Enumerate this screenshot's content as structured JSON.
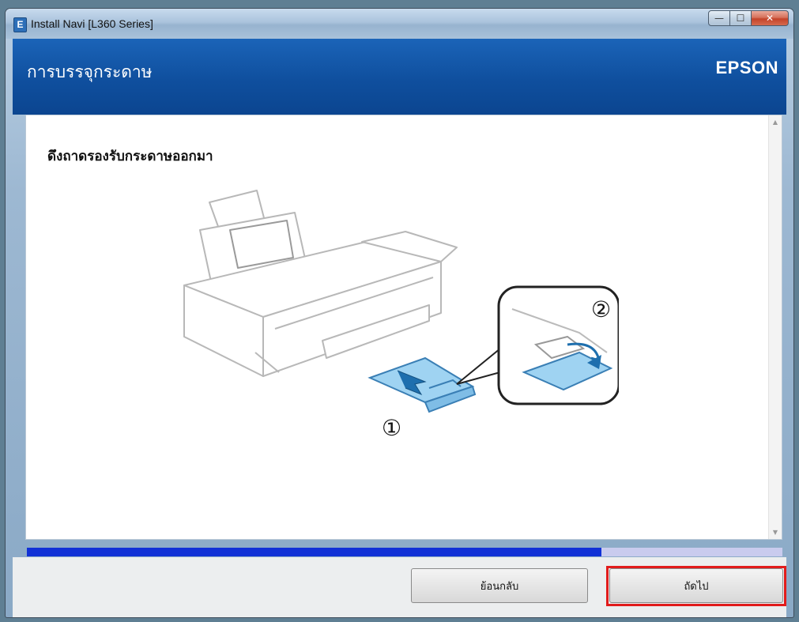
{
  "window": {
    "title": "Install Navi [L360 Series]",
    "app_icon_letter": "E",
    "controls": {
      "minimize": "—",
      "maximize": "☐",
      "close": "✕"
    }
  },
  "header": {
    "screen_title": "การบรรจุกระดาษ",
    "brand": "EPSON",
    "background_color": "#0f4f9e"
  },
  "content": {
    "instruction": "ดึงถาดรองรับกระดาษออกมา",
    "step_markers": [
      "①",
      "②"
    ]
  },
  "progress": {
    "value": 0.76,
    "fill_color": "#1131d6"
  },
  "footer": {
    "back_label": "ย้อนกลับ",
    "next_label": "ถัดไป",
    "highlight_color": "#e11b1b"
  }
}
